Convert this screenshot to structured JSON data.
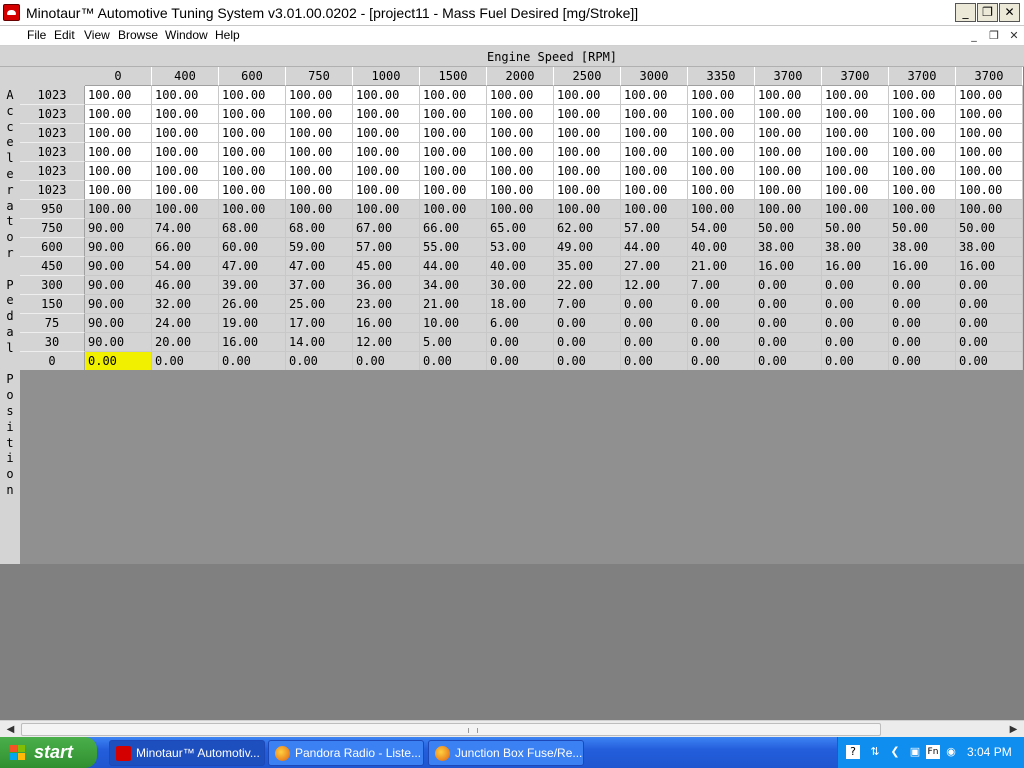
{
  "window": {
    "title": "Minotaur™ Automotive Tuning System  v3.01.00.0202 - [project11 - Mass Fuel Desired [mg/Stroke]]",
    "minimize_glyph": "_",
    "restore_glyph": "❐",
    "close_glyph": "✕"
  },
  "menu": [
    "File",
    "Edit",
    "View",
    "Browse",
    "Window",
    "Help"
  ],
  "mdi_controls": [
    "_",
    "❐",
    "✕"
  ],
  "table": {
    "x_axis_title": "Engine Speed [RPM]",
    "y_axis_title": "Accelerator Pedal Position",
    "column_headers": [
      "0",
      "400",
      "600",
      "750",
      "1000",
      "1500",
      "2000",
      "2500",
      "3000",
      "3350",
      "3700",
      "3700",
      "3700",
      "3700"
    ],
    "rows": [
      {
        "header": "1023",
        "values": [
          "100.00",
          "100.00",
          "100.00",
          "100.00",
          "100.00",
          "100.00",
          "100.00",
          "100.00",
          "100.00",
          "100.00",
          "100.00",
          "100.00",
          "100.00",
          "100.00"
        ]
      },
      {
        "header": "1023",
        "values": [
          "100.00",
          "100.00",
          "100.00",
          "100.00",
          "100.00",
          "100.00",
          "100.00",
          "100.00",
          "100.00",
          "100.00",
          "100.00",
          "100.00",
          "100.00",
          "100.00"
        ]
      },
      {
        "header": "1023",
        "values": [
          "100.00",
          "100.00",
          "100.00",
          "100.00",
          "100.00",
          "100.00",
          "100.00",
          "100.00",
          "100.00",
          "100.00",
          "100.00",
          "100.00",
          "100.00",
          "100.00"
        ]
      },
      {
        "header": "1023",
        "values": [
          "100.00",
          "100.00",
          "100.00",
          "100.00",
          "100.00",
          "100.00",
          "100.00",
          "100.00",
          "100.00",
          "100.00",
          "100.00",
          "100.00",
          "100.00",
          "100.00"
        ]
      },
      {
        "header": "1023",
        "values": [
          "100.00",
          "100.00",
          "100.00",
          "100.00",
          "100.00",
          "100.00",
          "100.00",
          "100.00",
          "100.00",
          "100.00",
          "100.00",
          "100.00",
          "100.00",
          "100.00"
        ]
      },
      {
        "header": "1023",
        "values": [
          "100.00",
          "100.00",
          "100.00",
          "100.00",
          "100.00",
          "100.00",
          "100.00",
          "100.00",
          "100.00",
          "100.00",
          "100.00",
          "100.00",
          "100.00",
          "100.00"
        ]
      },
      {
        "header": "950",
        "values": [
          "100.00",
          "100.00",
          "100.00",
          "100.00",
          "100.00",
          "100.00",
          "100.00",
          "100.00",
          "100.00",
          "100.00",
          "100.00",
          "100.00",
          "100.00",
          "100.00"
        ]
      },
      {
        "header": "750",
        "values": [
          "90.00",
          "74.00",
          "68.00",
          "68.00",
          "67.00",
          "66.00",
          "65.00",
          "62.00",
          "57.00",
          "54.00",
          "50.00",
          "50.00",
          "50.00",
          "50.00"
        ]
      },
      {
        "header": "600",
        "values": [
          "90.00",
          "66.00",
          "60.00",
          "59.00",
          "57.00",
          "55.00",
          "53.00",
          "49.00",
          "44.00",
          "40.00",
          "38.00",
          "38.00",
          "38.00",
          "38.00"
        ]
      },
      {
        "header": "450",
        "values": [
          "90.00",
          "54.00",
          "47.00",
          "47.00",
          "45.00",
          "44.00",
          "40.00",
          "35.00",
          "27.00",
          "21.00",
          "16.00",
          "16.00",
          "16.00",
          "16.00"
        ]
      },
      {
        "header": "300",
        "values": [
          "90.00",
          "46.00",
          "39.00",
          "37.00",
          "36.00",
          "34.00",
          "30.00",
          "22.00",
          "12.00",
          "7.00",
          "0.00",
          "0.00",
          "0.00",
          "0.00"
        ]
      },
      {
        "header": "150",
        "values": [
          "90.00",
          "32.00",
          "26.00",
          "25.00",
          "23.00",
          "21.00",
          "18.00",
          "7.00",
          "0.00",
          "0.00",
          "0.00",
          "0.00",
          "0.00",
          "0.00"
        ]
      },
      {
        "header": "75",
        "values": [
          "90.00",
          "24.00",
          "19.00",
          "17.00",
          "16.00",
          "10.00",
          "6.00",
          "0.00",
          "0.00",
          "0.00",
          "0.00",
          "0.00",
          "0.00",
          "0.00"
        ]
      },
      {
        "header": "30",
        "values": [
          "90.00",
          "20.00",
          "16.00",
          "14.00",
          "12.00",
          "5.00",
          "0.00",
          "0.00",
          "0.00",
          "0.00",
          "0.00",
          "0.00",
          "0.00",
          "0.00"
        ]
      },
      {
        "header": "0",
        "values": [
          "0.00",
          "0.00",
          "0.00",
          "0.00",
          "0.00",
          "0.00",
          "0.00",
          "0.00",
          "0.00",
          "0.00",
          "0.00",
          "0.00",
          "0.00",
          "0.00"
        ]
      }
    ],
    "selected_cell": {
      "row": 14,
      "col": 0
    },
    "colors": {
      "white_rows": "#ffffff",
      "gray_rows": "#d4d4d4",
      "selection": "#f0f000"
    }
  },
  "taskbar": {
    "start_label": "start",
    "tasks": [
      {
        "label": "Minotaur™ Automotiv...",
        "icon": "minotaur-icon",
        "active": true
      },
      {
        "label": "Pandora Radio - Liste...",
        "icon": "firefox-icon",
        "active": false
      },
      {
        "label": "Junction Box Fuse/Re...",
        "icon": "firefox-icon",
        "active": false
      }
    ],
    "clock": "3:04 PM"
  }
}
